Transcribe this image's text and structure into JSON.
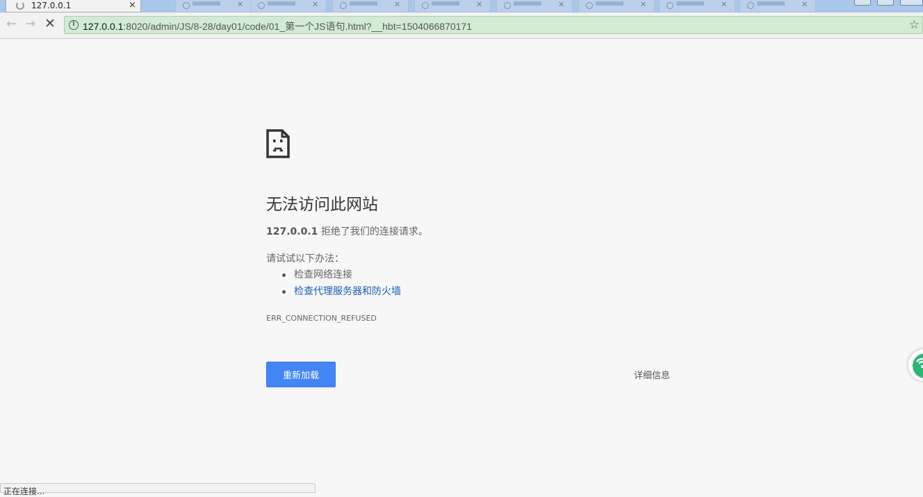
{
  "browser": {
    "active_tab": {
      "title": "127.0.0.1",
      "close": "×"
    },
    "url_host": "127.0.0.1",
    "url_rest": ":8020/admin/JS/8-28/day01/code/01_第一个JS语句.html?__hbt=1504066870171",
    "status": "正在连接..."
  },
  "error_page": {
    "heading": "无法访问此网站",
    "host": "127.0.0.1",
    "refused_text": " 拒绝了我们的连接请求。",
    "try_text": "请试试以下办法：",
    "suggestions": [
      "检查网络连接",
      "检查代理服务器和防火墙"
    ],
    "error_code": "ERR_CONNECTION_REFUSED",
    "reload_label": "重新加载",
    "details_label": "详细信息"
  },
  "colors": {
    "accent": "#4285f4",
    "link": "#1a5fb4",
    "omnibox_bg": "#d3ebd3"
  }
}
